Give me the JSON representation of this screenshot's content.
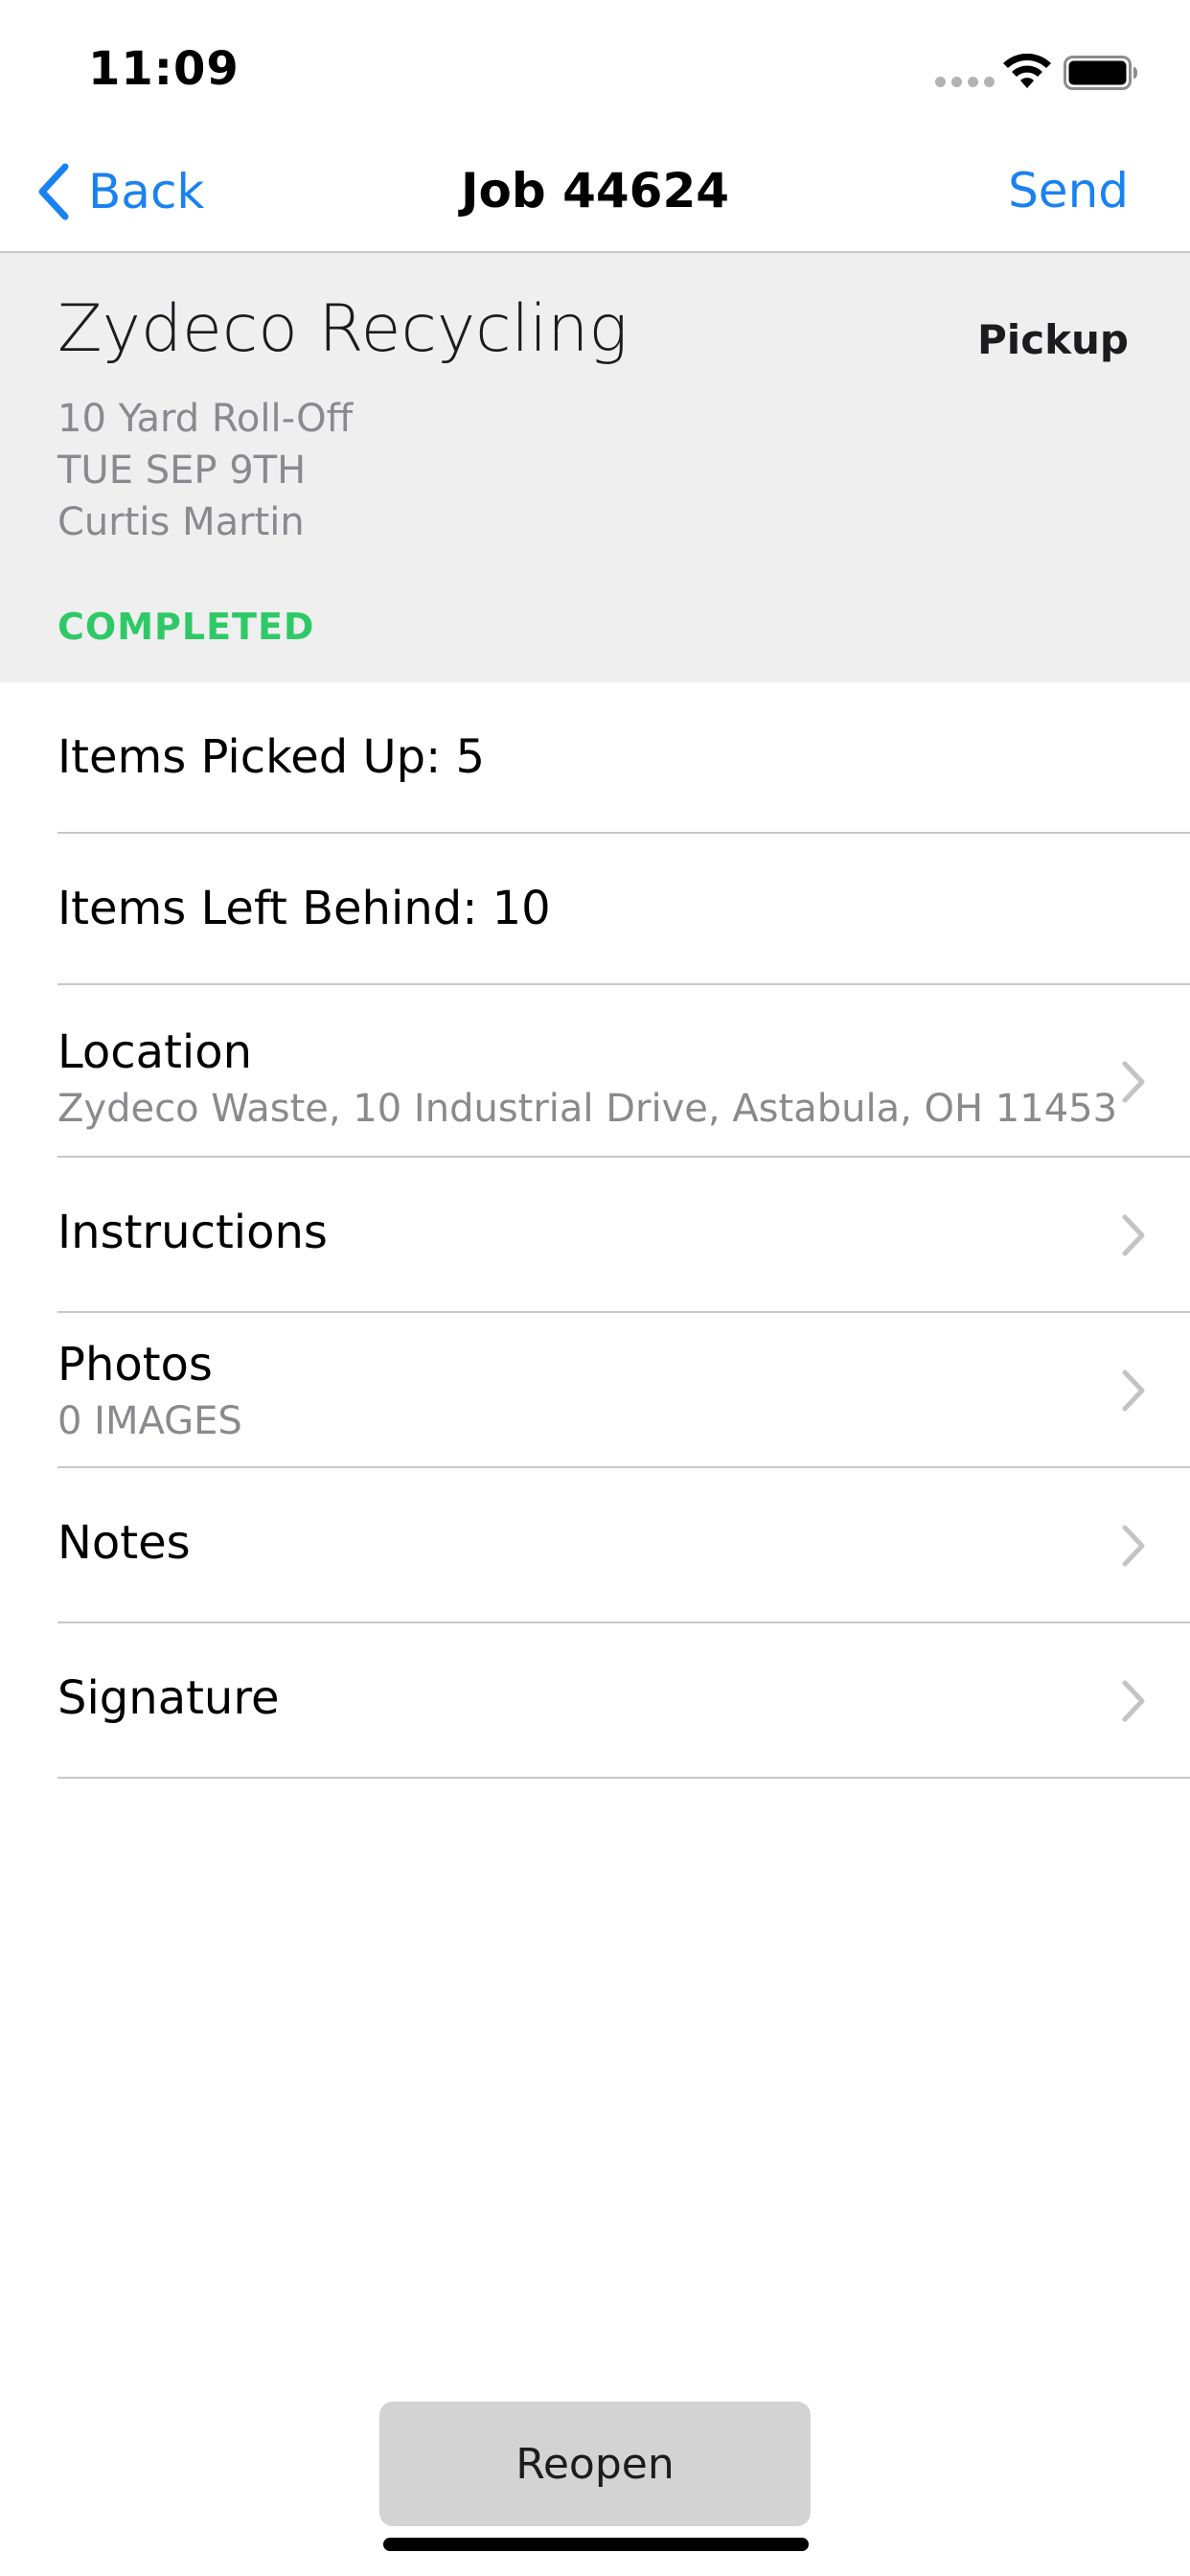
{
  "status_bar": {
    "time": "11:09"
  },
  "nav": {
    "back_label": "Back",
    "title": "Job 44624",
    "send_label": "Send",
    "accent_color": "#1a82f0"
  },
  "job": {
    "customer_name": "Zydeco Recycling",
    "job_type": "Pickup",
    "container": "10 Yard Roll-Off",
    "date": "TUE SEP 9TH",
    "driver": "Curtis Martin",
    "status": "COMPLETED",
    "status_color": "#2ec966"
  },
  "rows": {
    "items_picked_up": {
      "label": "Items Picked Up:",
      "value": "5"
    },
    "items_left_behind": {
      "label": "Items Left Behind:",
      "value": "10"
    },
    "location": {
      "label": "Location",
      "detail": "Zydeco Waste, 10 Industrial Drive, Astabula, OH 11453"
    },
    "instructions": {
      "label": "Instructions"
    },
    "photos": {
      "label": "Photos",
      "detail": "0 IMAGES"
    },
    "notes": {
      "label": "Notes"
    },
    "signature": {
      "label": "Signature"
    }
  },
  "actions": {
    "reopen_label": "Reopen"
  }
}
